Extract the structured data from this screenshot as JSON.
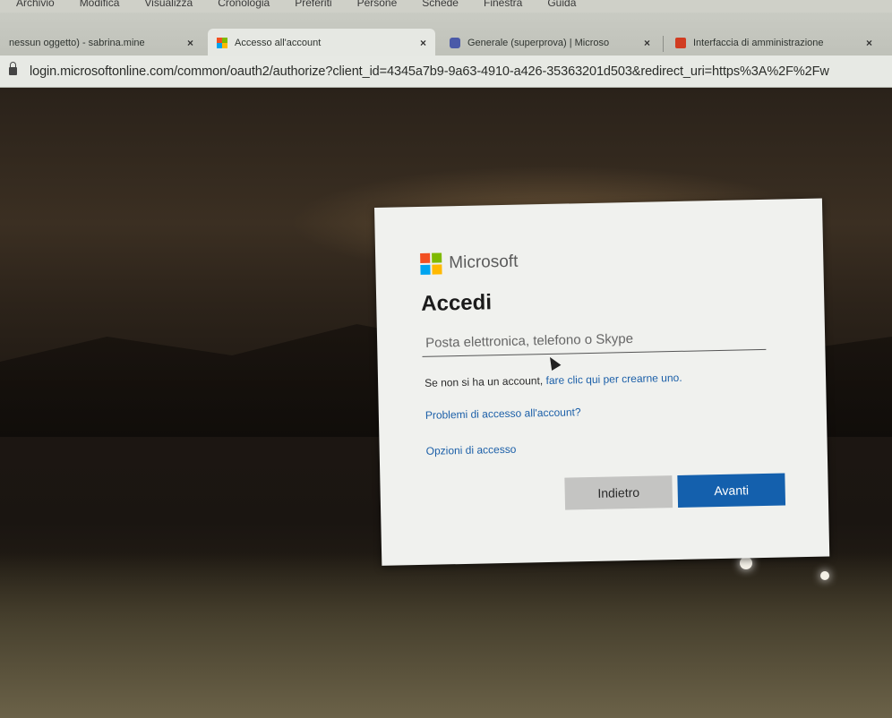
{
  "menubar": {
    "items": [
      "Archivio",
      "Modifica",
      "Visualizza",
      "Cronologia",
      "Preferiti",
      "Persone",
      "Schede",
      "Finestra",
      "Guida"
    ]
  },
  "tabs": [
    {
      "label": "nessun oggetto) - sabrina.mine",
      "close": "×",
      "active": false,
      "icon": "none"
    },
    {
      "label": "Accesso all'account",
      "close": "×",
      "active": true,
      "icon": "microsoft-icon"
    },
    {
      "label": "Generale (superprova) | Microso",
      "close": "×",
      "active": false,
      "icon": "teams-icon"
    },
    {
      "label": "Interfaccia di amministrazione",
      "close": "×",
      "active": false,
      "icon": "office-icon"
    }
  ],
  "address": {
    "url": "login.microsoftonline.com/common/oauth2/authorize?client_id=4345a7b9-9a63-4910-a426-35363201d503&redirect_uri=https%3A%2F%2Fw"
  },
  "login": {
    "brand": "Microsoft",
    "title": "Accedi",
    "email_placeholder": "Posta elettronica, telefono o Skype",
    "email_value": "",
    "signup_prefix": "Se non si ha un account,",
    "signup_link": "fare clic qui per crearne uno.",
    "trouble_link": "Problemi di accesso all'account?",
    "options_link": "Opzioni di accesso",
    "back_button": "Indietro",
    "next_button": "Avanti"
  },
  "colors": {
    "ms_red": "#f25022",
    "ms_green": "#7fba00",
    "ms_blue": "#00a4ef",
    "ms_yellow": "#ffb900",
    "primary_button": "#1460ad",
    "link": "#1b5fa8"
  }
}
